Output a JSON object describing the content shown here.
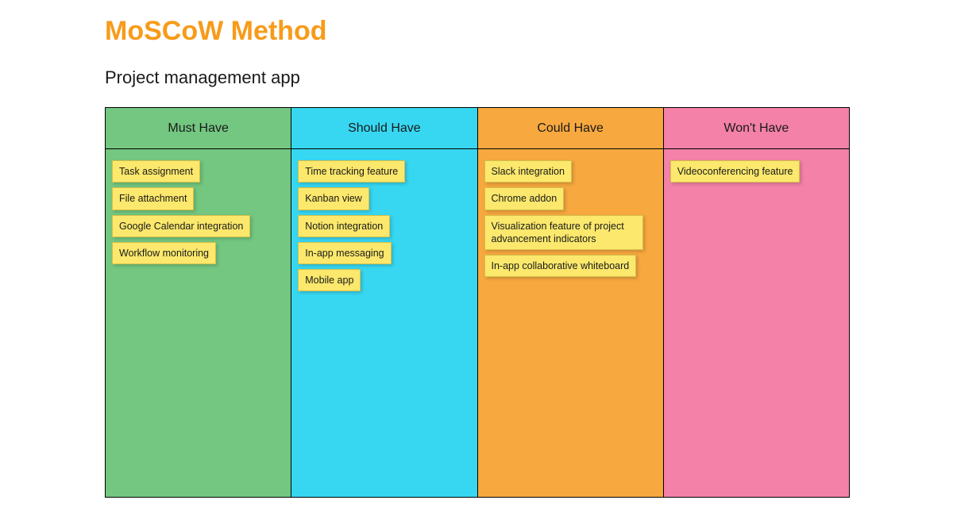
{
  "title": "MoSCoW Method",
  "subtitle": "Project management app",
  "colors": {
    "accent": "#f79b1a",
    "card_bg": "#fbe86c",
    "columns": [
      "#73c780",
      "#37d7f2",
      "#f7a83f",
      "#f381a8"
    ]
  },
  "columns": [
    {
      "header": "Must Have",
      "items": [
        "Task assignment",
        "File attachment",
        "Google Calendar integration",
        "Workflow monitoring"
      ]
    },
    {
      "header": "Should Have",
      "items": [
        "Time tracking feature",
        "Kanban view",
        "Notion integration",
        "In-app messaging",
        "Mobile app"
      ]
    },
    {
      "header": "Could Have",
      "items": [
        "Slack integration",
        "Chrome addon",
        "Visualization feature of project advancement indicators",
        "In-app collaborative whiteboard"
      ]
    },
    {
      "header": "Won't Have",
      "items": [
        "Videoconferencing feature"
      ]
    }
  ]
}
